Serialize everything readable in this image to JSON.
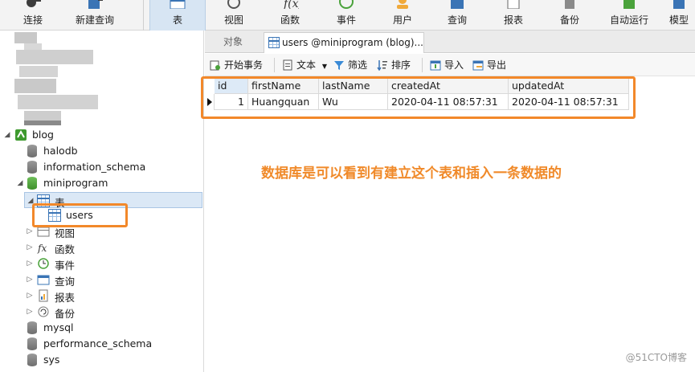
{
  "toolbar": {
    "items": [
      {
        "label": "连接",
        "icon": "connect-icon"
      },
      {
        "label": "新建查询",
        "icon": "new-query-icon"
      },
      {
        "label": "表",
        "icon": "table-icon"
      },
      {
        "label": "视图",
        "icon": "view-icon"
      },
      {
        "label": "函数",
        "icon": "function-icon"
      },
      {
        "label": "事件",
        "icon": "event-icon"
      },
      {
        "label": "用户",
        "icon": "user-icon"
      },
      {
        "label": "查询",
        "icon": "query-icon"
      },
      {
        "label": "报表",
        "icon": "report-icon"
      },
      {
        "label": "备份",
        "icon": "backup-icon"
      },
      {
        "label": "自动运行",
        "icon": "automation-icon"
      },
      {
        "label": "模型",
        "icon": "model-icon"
      }
    ],
    "active": "表"
  },
  "tree": {
    "connection": "blog",
    "databases": [
      "halodb",
      "information_schema",
      "miniprogram",
      "mysql",
      "performance_schema",
      "sys"
    ],
    "open_database": "miniprogram",
    "table_group": "表",
    "tables": [
      "users"
    ],
    "groups": [
      "视图",
      "函数",
      "事件",
      "查询",
      "报表",
      "备份"
    ]
  },
  "tabs": {
    "objects": "对象",
    "users": "users @miniprogram (blog)..."
  },
  "subtoolbar": {
    "begin_transaction": "开始事务",
    "text": "文本",
    "filter": "筛选",
    "sort": "排序",
    "import": "导入",
    "export": "导出"
  },
  "grid": {
    "columns": [
      "id",
      "firstName",
      "lastName",
      "createdAt",
      "updatedAt"
    ],
    "rows": [
      [
        "1",
        "Huangquan",
        "Wu",
        "2020-04-11 08:57:31",
        "2020-04-11 08:57:31"
      ]
    ]
  },
  "annotation": "数据库是可以看到有建立这个表和插入一条数据的",
  "watermark": "@51CTO博客",
  "colors": {
    "highlight": "#f2882a",
    "annotation": "#f08a2a",
    "selection": "#dbe8f6"
  }
}
